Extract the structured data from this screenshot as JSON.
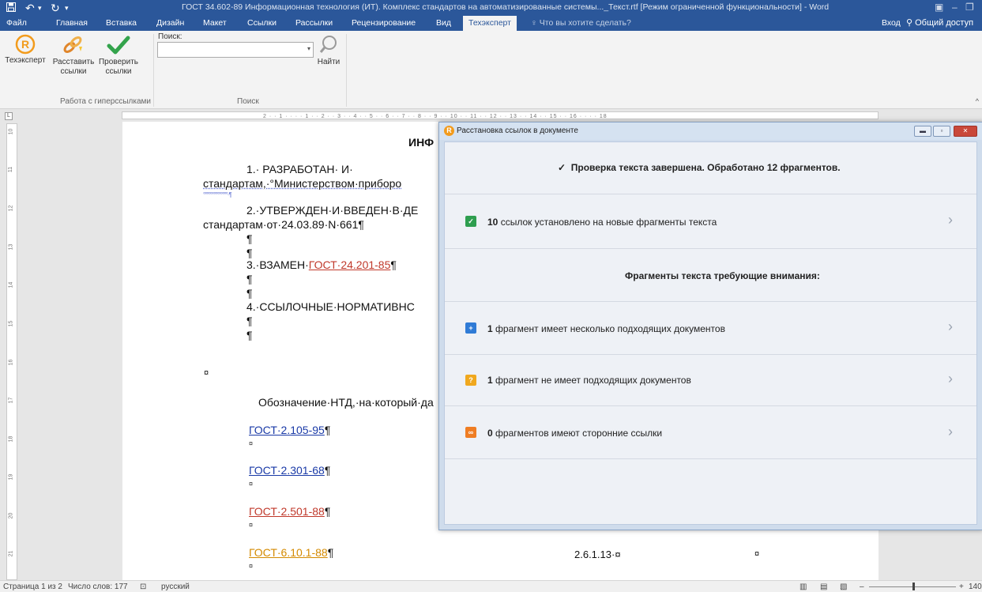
{
  "titlebar": {
    "save_icon": "save-icon",
    "undo_icon": "undo-icon",
    "redo_icon": "redo-icon",
    "title": "ГОСТ 34.602-89 Информационная технология (ИТ). Комплекс стандартов на автоматизированные системы..._Текст.rtf [Режим ограниченной функциональности] - Word"
  },
  "tabs": [
    "Файл",
    "Главная",
    "Вставка",
    "Дизайн",
    "Макет",
    "Ссылки",
    "Рассылки",
    "Рецензирование",
    "Вид",
    "Техэксперт"
  ],
  "tell_me": "Что вы хотите сделать?",
  "sign_in": "Вход",
  "share": "Общий доступ",
  "ribbon": {
    "btn_texexpert": "Техэксперт",
    "btn_place_links_1": "Расставить",
    "btn_place_links_2": "ссылки",
    "btn_check_links_1": "Проверить",
    "btn_check_links_2": "ссылки",
    "group_hyperlinks": "Работа с гиперссылками",
    "search_label": "Поиск:",
    "search_value": "",
    "btn_find": "Найти",
    "group_search": "Поиск"
  },
  "ruler_numbers": "2 · · 1 · · · · 1 · · 2 · · 3 · · 4 · · 5 · · 6 · · 7 · · 8 · · 9 · · 10 · · 11 · · 12 · · 13 · · 14 · · 15 · · 16 · · · · 18",
  "left_ruler": [
    "10",
    "11",
    "12",
    "13",
    "14",
    "15",
    "16",
    "17",
    "18",
    "19",
    "20",
    "21"
  ],
  "document": {
    "heading": "ИНФ",
    "p1_a": "1.·     РАЗРАБОТАН·     И·",
    "p1_b": "стандартам,·°Министерством·приборо",
    "p1_c": "°°°°°°°°°°°°°°·¶",
    "p2_a": "2.·УТВЕРЖДЕН·И·ВВЕДЕН·В·ДЕ",
    "p2_b": "стандартам·от·24.03.89·N·661¶",
    "pilcrow": "¶",
    "p3_prefix": "3.·ВЗАМЕН·",
    "p3_link": "ГОСТ·24.201-85",
    "p3_suffix": "¶",
    "p4": "4.·ССЫЛОЧНЫЕ·НОРМАТИВНС",
    "cell_mark": "¤",
    "table_header": "Обозначение·НТД,·на·который·да",
    "gost1": "ГОСТ·2.105-95",
    "gost2": "ГОСТ·2.301-68",
    "gost3": "ГОСТ·2.501-88",
    "gost4": "ГОСТ·6.10.1-88",
    "ref_value": "2.6.1.13·¤"
  },
  "status": {
    "page": "Страница 1 из 2",
    "words": "Число слов: 177",
    "language": "русский",
    "zoom": "140%"
  },
  "dialog": {
    "title": "Расстановка ссылок в документе",
    "check_done": "Проверка текста завершена. Обработано 12 фрагментов.",
    "row1_count": "10",
    "row1_text": "ссылок установлено на новые фрагменты текста",
    "attention_heading": "Фрагменты текста требующие внимания:",
    "row2_count": "1",
    "row2_text": "фрагмент имеет несколько подходящих документов",
    "row3_count": "1",
    "row3_text": "фрагмент не имеет подходящих документов",
    "row4_count": "0",
    "row4_text": "фрагментов имеют сторонние ссылки",
    "colors": {
      "row1": "#2e9e4f",
      "row2": "#2f7bd6",
      "row3": "#f0a81e",
      "row4": "#ef7d23"
    }
  }
}
